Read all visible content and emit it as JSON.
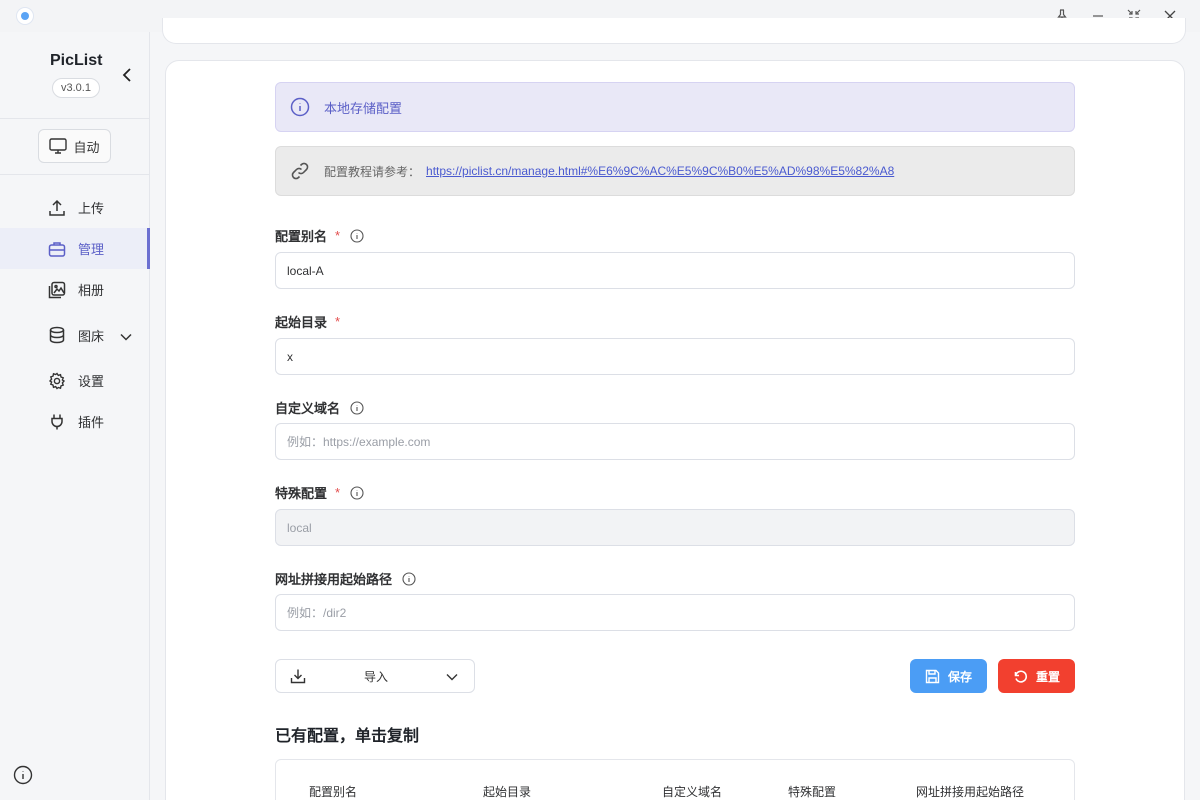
{
  "app": {
    "name": "PicList",
    "version": "v3.0.1"
  },
  "sidebar": {
    "mode_label": "自动",
    "items": [
      {
        "label": "上传",
        "icon": "upload-icon",
        "active": false
      },
      {
        "label": "管理",
        "icon": "briefcase-icon",
        "active": true
      },
      {
        "label": "相册",
        "icon": "gallery-icon",
        "active": false
      },
      {
        "label": "图床",
        "icon": "database-icon",
        "active": false,
        "expandable": true
      },
      {
        "label": "设置",
        "icon": "gear-icon",
        "active": false
      },
      {
        "label": "插件",
        "icon": "plug-icon",
        "active": false
      }
    ]
  },
  "alerts": {
    "info_text": "本地存储配置",
    "link_prefix": "配置教程请参考：",
    "link_text": "https://piclist.cn/manage.html#%E6%9C%AC%E5%9C%B0%E5%AD%98%E5%82%A8"
  },
  "form": {
    "alias": {
      "label": "配置别名",
      "required": true,
      "value": "local-A"
    },
    "base_dir": {
      "label": "起始目录",
      "required": true,
      "value": "x"
    },
    "custom_domain": {
      "label": "自定义域名",
      "required": false,
      "placeholder": "例如：https://example.com"
    },
    "special": {
      "label": "特殊配置",
      "required": true,
      "placeholder": "local"
    },
    "url_prefix": {
      "label": "网址拼接用起始路径",
      "required": false,
      "placeholder": "例如：/dir2"
    }
  },
  "actions": {
    "import_label": "导入",
    "save_label": "保存",
    "reset_label": "重置"
  },
  "existing": {
    "title": "已有配置，单击复制",
    "columns": [
      "配置别名",
      "起始目录",
      "自定义域名",
      "特殊配置",
      "网址拼接用起始路径"
    ]
  },
  "colors": {
    "accent": "#5b5fc7",
    "save": "#4b9df5",
    "reset": "#f2402f",
    "required": "#e34d4d"
  }
}
